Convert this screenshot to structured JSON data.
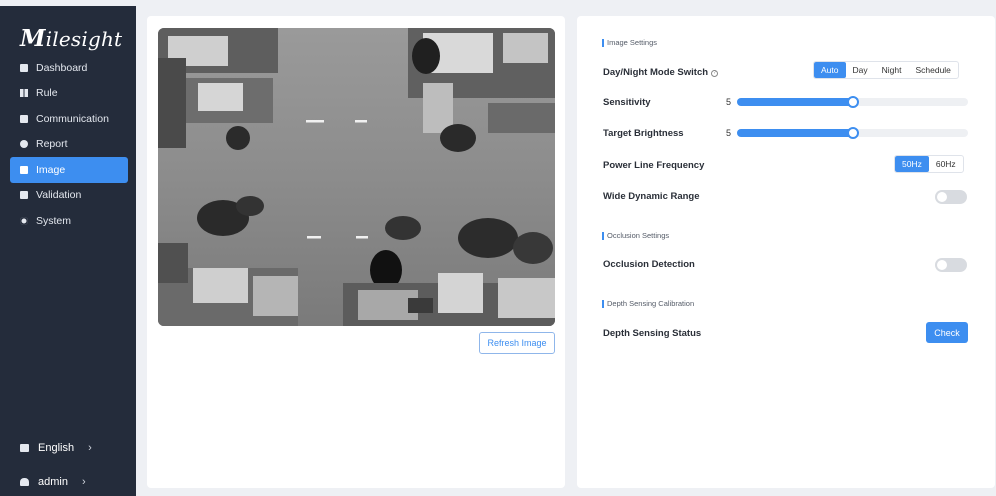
{
  "brand": {
    "logo_initial": "M",
    "logo_rest": "ilesight"
  },
  "sidebar": {
    "items": [
      {
        "label": "Dashboard",
        "icon": "dashboard-icon"
      },
      {
        "label": "Rule",
        "icon": "rule-icon"
      },
      {
        "label": "Communication",
        "icon": "communication-icon"
      },
      {
        "label": "Report",
        "icon": "report-icon"
      },
      {
        "label": "Image",
        "icon": "image-icon",
        "active": true
      },
      {
        "label": "Validation",
        "icon": "validation-icon"
      },
      {
        "label": "System",
        "icon": "gear-icon"
      }
    ],
    "language": {
      "label": "English",
      "chevron": "›"
    },
    "user": {
      "label": "admin",
      "chevron": "›"
    }
  },
  "left_panel": {
    "camera_alt": "overhead camera view",
    "refresh_label": "Refresh Image"
  },
  "image_settings": {
    "section_title": "Image Settings",
    "day_night": {
      "label": "Day/Night Mode Switch",
      "help": "?",
      "options": [
        "Auto",
        "Day",
        "Night",
        "Schedule"
      ],
      "selected": "Auto"
    },
    "sensitivity": {
      "label": "Sensitivity",
      "value": "5",
      "fraction": 0.5
    },
    "target_brightness": {
      "label": "Target Brightness",
      "value": "5",
      "fraction": 0.5
    },
    "power_line": {
      "label": "Power Line Frequency",
      "options": [
        "50Hz",
        "60Hz"
      ],
      "selected": "50Hz"
    },
    "wdr": {
      "label": "Wide Dynamic Range",
      "enabled": false
    }
  },
  "occlusion_settings": {
    "section_title": "Occlusion Settings",
    "detection": {
      "label": "Occlusion Detection",
      "enabled": false
    }
  },
  "depth_calibration": {
    "section_title": "Depth Sensing Calibration",
    "status": {
      "label": "Depth Sensing Status",
      "button": "Check"
    }
  },
  "colors": {
    "accent": "#3d8ef0",
    "sidebar_bg": "#242c3b",
    "page_bg": "#eef0f4"
  }
}
